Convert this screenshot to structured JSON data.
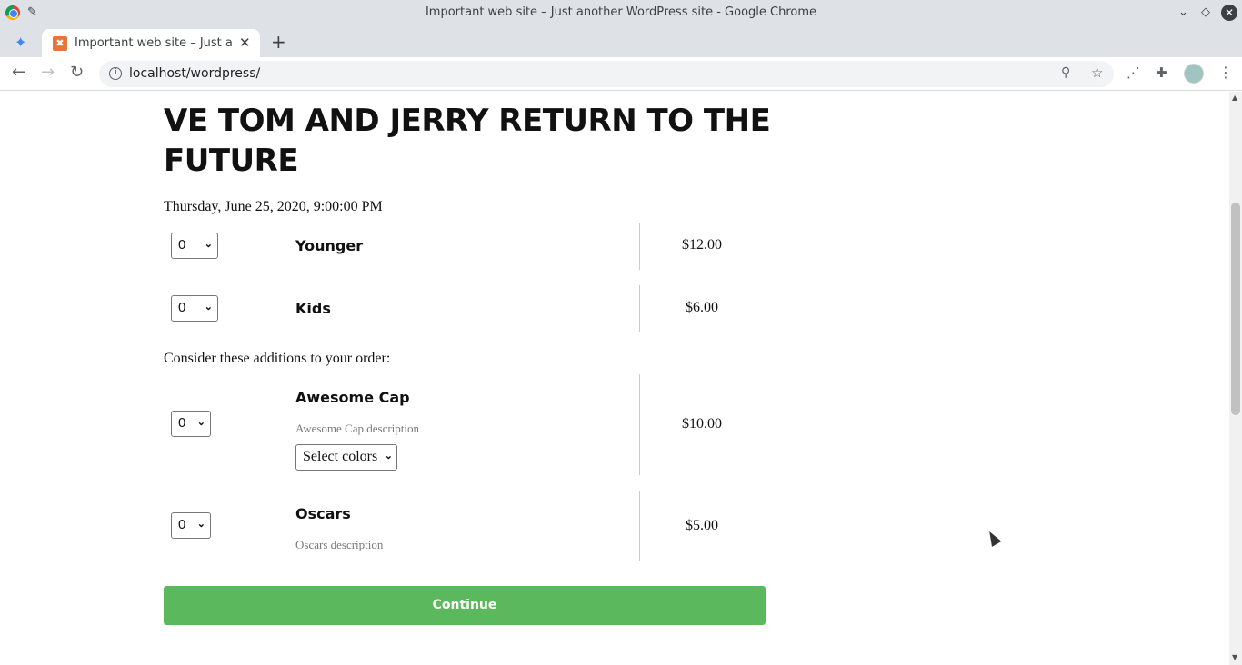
{
  "window": {
    "title": "Important web site – Just another WordPress site - Google Chrome"
  },
  "tabs": [
    {
      "label": "Important web site – Just another WordPress site",
      "active": true
    }
  ],
  "toolbar": {
    "url": "localhost/wordpress/"
  },
  "event": {
    "title": "VE TOM AND JERRY RETURN TO THE FUTURE",
    "date": "Thursday, June 25, 2020, 9:00:00 PM"
  },
  "tickets": [
    {
      "qty": "0",
      "name": "Younger",
      "price": "$12.00"
    },
    {
      "qty": "0",
      "name": "Kids",
      "price": "$6.00"
    }
  ],
  "addons_label": "Consider these additions to your order:",
  "addons": [
    {
      "qty": "0",
      "name": "Awesome Cap",
      "description": "Awesome Cap description",
      "price": "$10.00",
      "option": "Select colors"
    },
    {
      "qty": "0",
      "name": "Oscars",
      "description": "Oscars description",
      "price": "$5.00"
    }
  ],
  "continue_label": "Continue",
  "colors": {
    "continue_button": "#5cb85c"
  }
}
